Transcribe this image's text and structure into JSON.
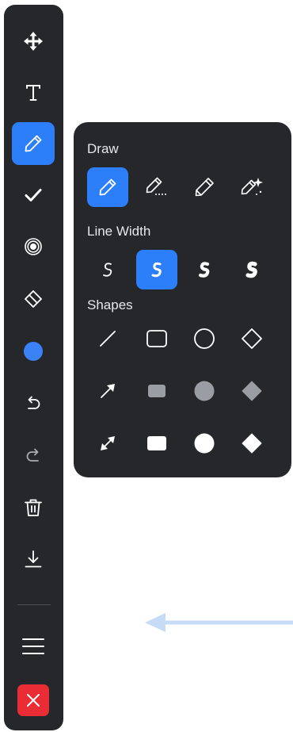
{
  "panel": {
    "draw_label": "Draw",
    "line_width_label": "Line Width",
    "shapes_label": "Shapes",
    "draw_tools": [
      {
        "name": "pencil",
        "selected": true
      },
      {
        "name": "pencil-dotted"
      },
      {
        "name": "pencil-outline"
      },
      {
        "name": "magic-pencil"
      }
    ],
    "line_widths": [
      {
        "level": 1,
        "selected": false
      },
      {
        "level": 2,
        "selected": true
      },
      {
        "level": 3,
        "selected": false
      },
      {
        "level": 4,
        "selected": false
      }
    ],
    "shapes": [
      [
        "line",
        "rectangle-outline",
        "circle-outline",
        "diamond-outline"
      ],
      [
        "arrow",
        "rectangle-gray",
        "circle-gray",
        "diamond-gray"
      ],
      [
        "double-arrow",
        "rectangle-white",
        "circle-white",
        "diamond-white"
      ]
    ]
  },
  "toolbar": {
    "tools": [
      "move",
      "text",
      "pencil",
      "check",
      "radio-target",
      "eraser",
      "color",
      "undo",
      "redo",
      "trash",
      "download",
      "menu",
      "close"
    ],
    "active_tool": "pencil",
    "current_color": "#3b82f6"
  },
  "colors": {
    "toolbar_bg": "#25272b",
    "accent": "#2d7ff9",
    "close": "#ea2d35",
    "hint_arrow": "#c7dbf7"
  }
}
